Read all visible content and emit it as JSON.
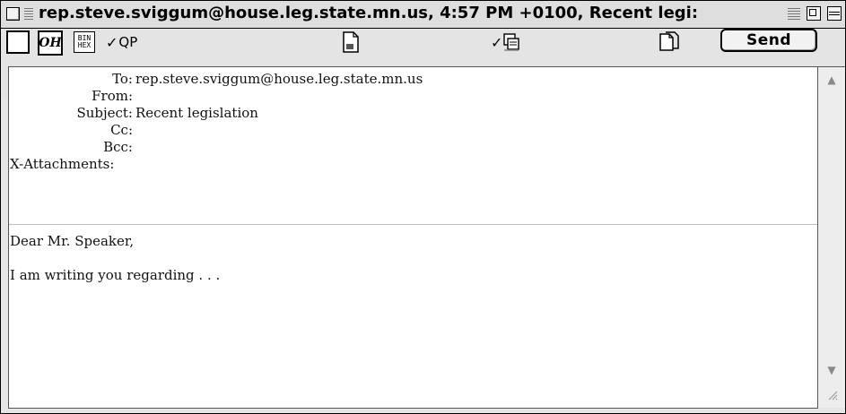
{
  "window": {
    "title": "rep.steve.sviggum@house.leg.state.mn.us, 4:57 PM +0100, Recent legi:"
  },
  "toolbar": {
    "emoji_label": "𝑶𝑯",
    "binhex_top": "BIN",
    "binhex_bottom": "HEX",
    "qp_label": "QP",
    "send_label": "Send"
  },
  "headers": [
    {
      "label": "To:",
      "value": "rep.steve.sviggum@house.leg.state.mn.us"
    },
    {
      "label": "From:",
      "value": ""
    },
    {
      "label": "Subject:",
      "value": "Recent legislation"
    },
    {
      "label": "Cc:",
      "value": ""
    },
    {
      "label": "Bcc:",
      "value": ""
    },
    {
      "label": "X-Attachments:",
      "value": ""
    }
  ],
  "body": {
    "lines": [
      "Dear Mr. Speaker,",
      "I am writing you regarding . . ."
    ]
  },
  "icons": {
    "close": "close-box",
    "zoom": "zoom-box",
    "collapse": "collapse-box",
    "scroll_up": "scroll-up-arrow",
    "scroll_down": "scroll-down-arrow",
    "resize": "resize-grip"
  }
}
